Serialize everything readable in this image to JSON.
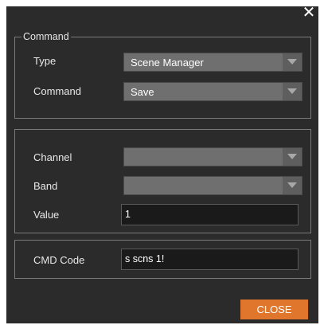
{
  "dialog": {
    "close_glyph": "✕",
    "close_button_label": "CLOSE",
    "accent_color": "#e0762c"
  },
  "command_group": {
    "legend": "Command",
    "type_label": "Type",
    "type_value": "Scene Manager",
    "command_label": "Command",
    "command_value": "Save"
  },
  "params_group": {
    "channel_label": "Channel",
    "channel_value": "",
    "band_label": "Band",
    "band_value": "",
    "value_label": "Value",
    "value_value": "1"
  },
  "cmd_group": {
    "cmd_code_label": "CMD Code",
    "cmd_code_value": "s scns 1!"
  },
  "icons": {
    "close": "close-icon",
    "dropdown": "chevron-down-icon"
  }
}
